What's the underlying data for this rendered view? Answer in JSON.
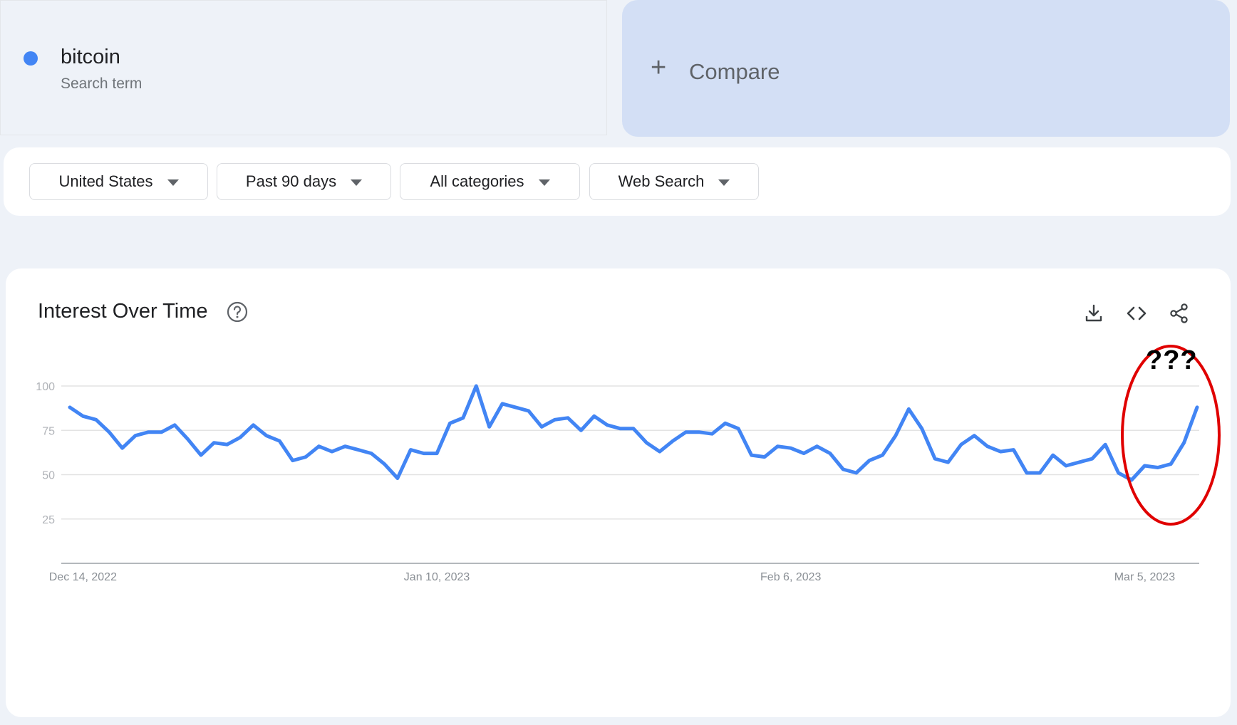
{
  "search_term": {
    "name": "bitcoin",
    "subtitle": "Search term",
    "color": "#4285f4"
  },
  "compare": {
    "plus": "+",
    "label": "Compare"
  },
  "filters": [
    {
      "label": "United States"
    },
    {
      "label": "Past 90 days"
    },
    {
      "label": "All categories"
    },
    {
      "label": "Web Search"
    }
  ],
  "chart_panel": {
    "title": "Interest Over Time",
    "icons": [
      "help-icon",
      "download-icon",
      "embed-code-icon",
      "share-icon"
    ],
    "annotation": "???",
    "annotation_color": "#e00000"
  },
  "chart_data": {
    "type": "line",
    "series": [
      {
        "values": [
          88,
          83,
          81,
          74,
          65,
          72,
          74,
          74,
          78,
          70,
          61,
          68,
          67,
          71,
          78,
          72,
          69,
          58,
          60,
          66,
          63,
          66,
          64,
          62,
          56,
          48,
          64,
          62,
          62,
          79,
          82,
          100,
          77,
          90,
          88,
          86,
          77,
          81,
          82,
          75,
          83,
          78,
          76,
          76,
          68,
          63,
          69,
          74,
          74,
          73,
          79,
          76,
          61,
          60,
          66,
          65,
          62,
          66,
          62,
          53,
          51,
          58,
          61,
          72,
          87,
          76,
          59,
          57,
          67,
          72,
          66,
          63,
          64,
          51,
          51,
          61,
          55,
          57,
          59,
          67,
          51,
          47,
          55,
          54,
          56,
          68,
          88
        ],
        "color": "#4285f4"
      }
    ],
    "x_start": "2022-12-13",
    "x_step_days": 1,
    "x_ticks": [
      {
        "label": "Dec 14, 2022",
        "x": "2022-12-14"
      },
      {
        "label": "Jan 10, 2023",
        "x": "2023-01-10"
      },
      {
        "label": "Feb 6, 2023",
        "x": "2023-02-06"
      },
      {
        "label": "Mar 5, 2023",
        "x": "2023-03-05"
      }
    ],
    "y_ticks": [
      100,
      75,
      50,
      25
    ],
    "ylim": [
      0,
      100
    ],
    "grid": true
  }
}
